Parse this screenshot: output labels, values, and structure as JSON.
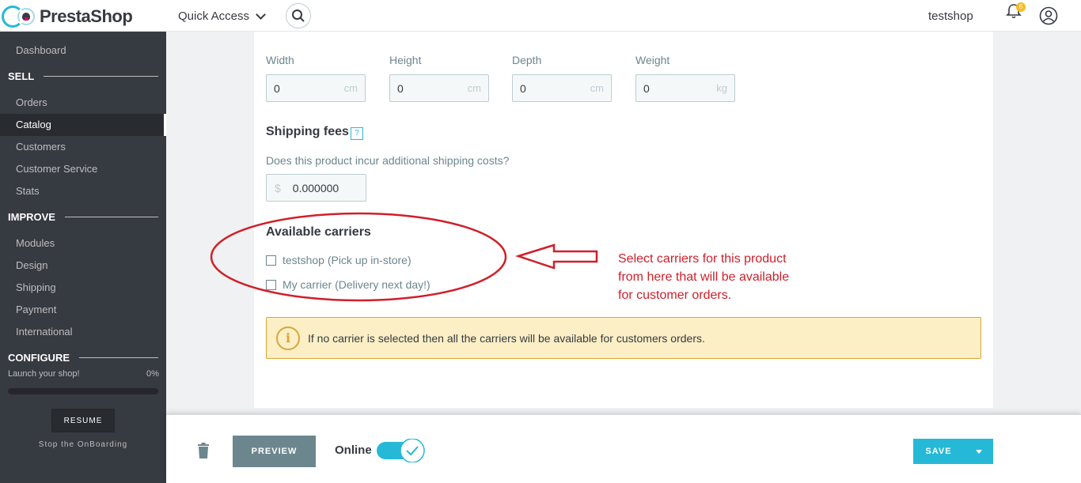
{
  "header": {
    "logo_text": "PrestaShop",
    "quick_access": "Quick Access",
    "shop_name": "testshop",
    "notification_count": "6",
    "icons": [
      "search-icon",
      "bell-icon",
      "user-icon",
      "chevron-down-icon"
    ]
  },
  "sidebar": {
    "dashboard": "Dashboard",
    "sections": {
      "sell": "SELL",
      "improve": "IMPROVE",
      "configure": "CONFIGURE"
    },
    "sell_items": [
      "Orders",
      "Catalog",
      "Customers",
      "Customer Service",
      "Stats"
    ],
    "improve_items": [
      "Modules",
      "Design",
      "Shipping",
      "Payment",
      "International"
    ],
    "active_item": "Catalog",
    "onboarding": {
      "label": "Launch your shop!",
      "progress": "0%",
      "progress_value": 0,
      "resume": "RESUME",
      "stop": "Stop the OnBoarding"
    }
  },
  "form": {
    "dimensions": [
      {
        "label": "Width",
        "value": "0",
        "unit": "cm"
      },
      {
        "label": "Height",
        "value": "0",
        "unit": "cm"
      },
      {
        "label": "Depth",
        "value": "0",
        "unit": "cm"
      },
      {
        "label": "Weight",
        "value": "0",
        "unit": "kg"
      }
    ],
    "shipping_fees": {
      "title": "Shipping fees",
      "help": "?",
      "question": "Does this product incur additional shipping costs?",
      "currency": "$",
      "value": "0.000000"
    },
    "carriers": {
      "title": "Available carriers",
      "items": [
        {
          "label": "testshop (Pick up in-store)",
          "checked": false
        },
        {
          "label": "My carrier (Delivery next day!)",
          "checked": false
        }
      ]
    },
    "alert": "If no carrier is selected then all the carriers will be available for customers orders."
  },
  "annotation": {
    "line1": "Select carriers for this product",
    "line2": "from here that will be available",
    "line3": "for customer orders.",
    "color": "#d01f2a"
  },
  "footer": {
    "preview": "PREVIEW",
    "online": "Online",
    "online_enabled": true,
    "save": "SAVE"
  },
  "colors": {
    "accent": "#25b9d7",
    "sidebar_bg": "#363a41",
    "alert_bg": "#fcefc5",
    "alert_border": "#d8a63a"
  }
}
